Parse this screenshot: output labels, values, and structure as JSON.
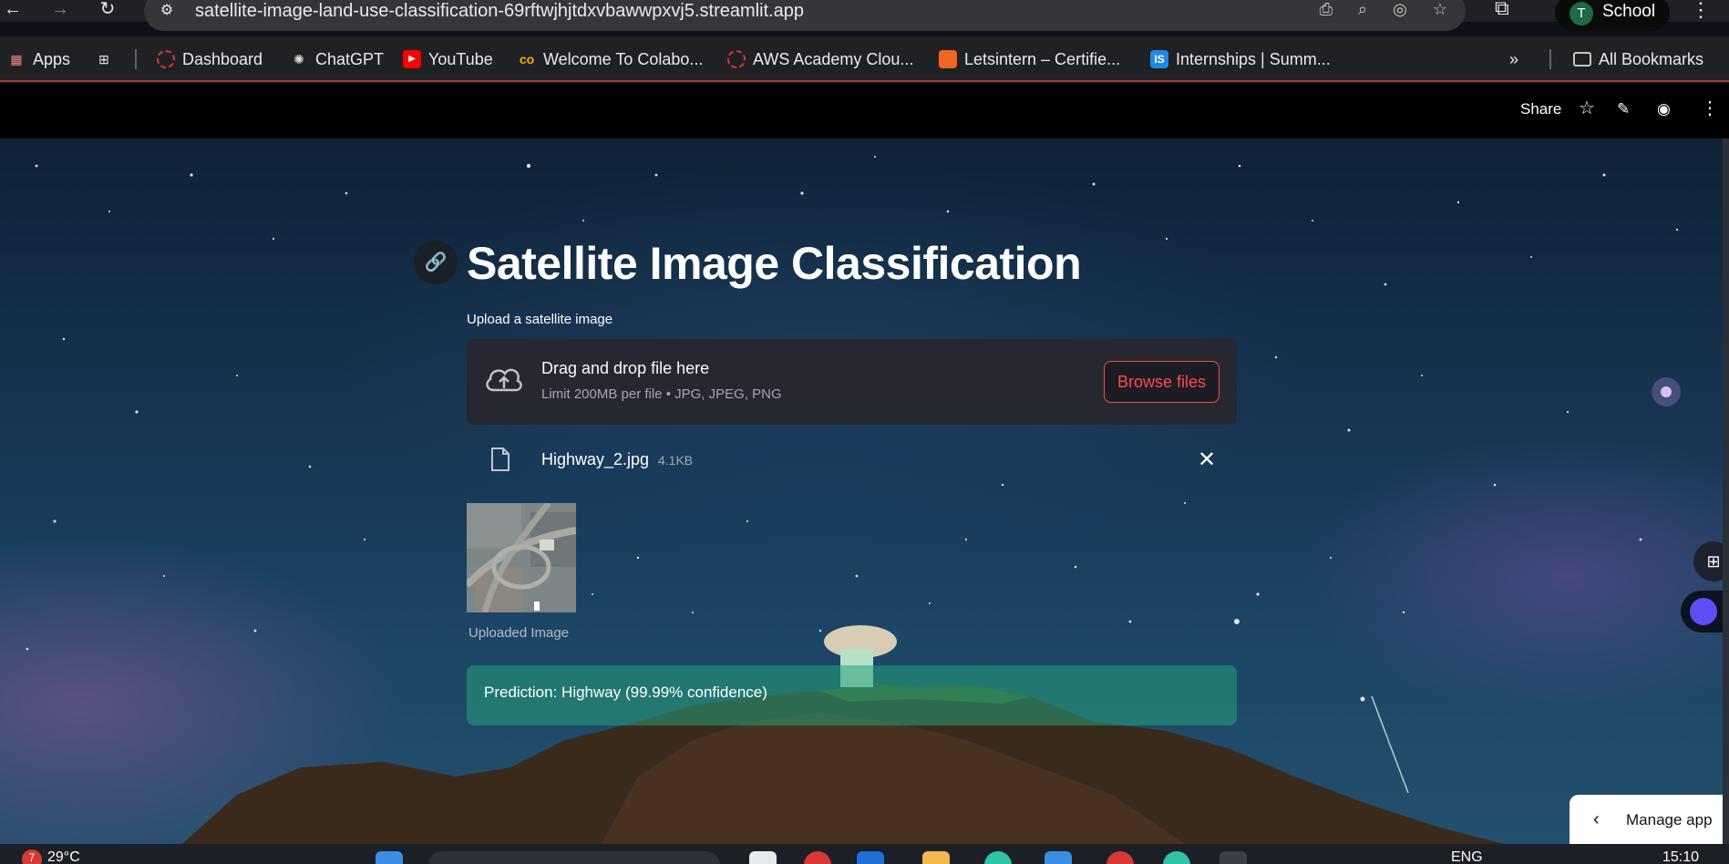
{
  "browser": {
    "url": "satellite-image-land-use-classification-69rftwjhjtdxvbawwpxvj5.streamlit.app",
    "profile_initial": "T",
    "profile_name": "School"
  },
  "bookmarks": {
    "items": [
      {
        "label": "Apps",
        "icon": "apps-grid-icon"
      },
      {
        "label": "Dashboard",
        "icon": "dashboard-icon"
      },
      {
        "label": "ChatGPT",
        "icon": "chatgpt-icon"
      },
      {
        "label": "YouTube",
        "icon": "youtube-icon"
      },
      {
        "label": "Welcome To Colabo...",
        "icon": "colab-icon"
      },
      {
        "label": "AWS Academy Clou...",
        "icon": "aws-icon"
      },
      {
        "label": "Letsintern – Certifie...",
        "icon": "letsintern-icon"
      },
      {
        "label": "Internships | Summ...",
        "icon": "internshala-icon"
      }
    ],
    "all_bookmarks": "All Bookmarks"
  },
  "streamlit_header": {
    "share_label": "Share"
  },
  "app": {
    "title": "Satellite Image Classification",
    "upload_label": "Upload a satellite image",
    "dropzone_title": "Drag and drop file here",
    "dropzone_subtitle": "Limit 200MB per file • JPG, JPEG, PNG",
    "browse_label": "Browse files",
    "file_name": "Highway_2.jpg",
    "file_size": "4.1KB",
    "image_caption": "Uploaded Image",
    "prediction": "Prediction: Highway (99.99% confidence)",
    "manage_app": "Manage app"
  },
  "taskbar": {
    "temperature": "29°C",
    "weather_badge": "7",
    "language": "ENG",
    "time": "15:10"
  },
  "colors": {
    "accent": "#ff4b4b",
    "success": "#24a078",
    "dropzone_bg": "#262730"
  }
}
